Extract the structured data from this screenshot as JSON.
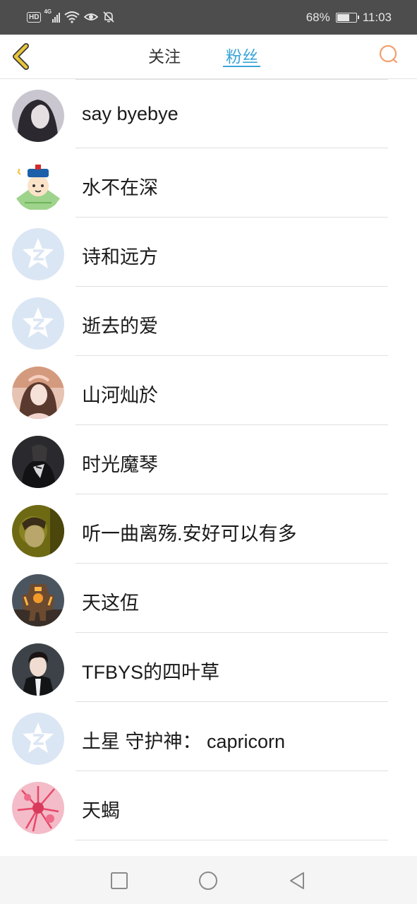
{
  "status_bar": {
    "hd_label": "HD",
    "network_label": "4G",
    "battery_percent": "68%",
    "battery_level": 0.68,
    "time": "11:03"
  },
  "nav": {
    "tabs": [
      {
        "label": "关注",
        "active": false
      },
      {
        "label": "粉丝",
        "active": true
      }
    ],
    "accent_color": "#3aa5d8",
    "back_icon_color": "#e8c53a",
    "search_icon_color": "#f0a070"
  },
  "fans": [
    {
      "name": "say byebye",
      "avatar": "photo-dark-hair"
    },
    {
      "name": "水不在深",
      "avatar": "cartoon-green"
    },
    {
      "name": "诗和远方",
      "avatar": "default-qq"
    },
    {
      "name": "逝去的爱",
      "avatar": "default-qq"
    },
    {
      "name": "山河灿於",
      "avatar": "photo-girl"
    },
    {
      "name": "时光魔琴",
      "avatar": "photo-dark"
    },
    {
      "name": "听一曲离殇.安好可以有多",
      "avatar": "photo-olive"
    },
    {
      "name": "天这仾",
      "avatar": "photo-robot"
    },
    {
      "name": "TFBYS的四叶草",
      "avatar": "photo-boy"
    },
    {
      "name": "土星 守护神： capricorn",
      "avatar": "default-qq"
    },
    {
      "name": "天蝎",
      "avatar": "photo-flower"
    }
  ]
}
